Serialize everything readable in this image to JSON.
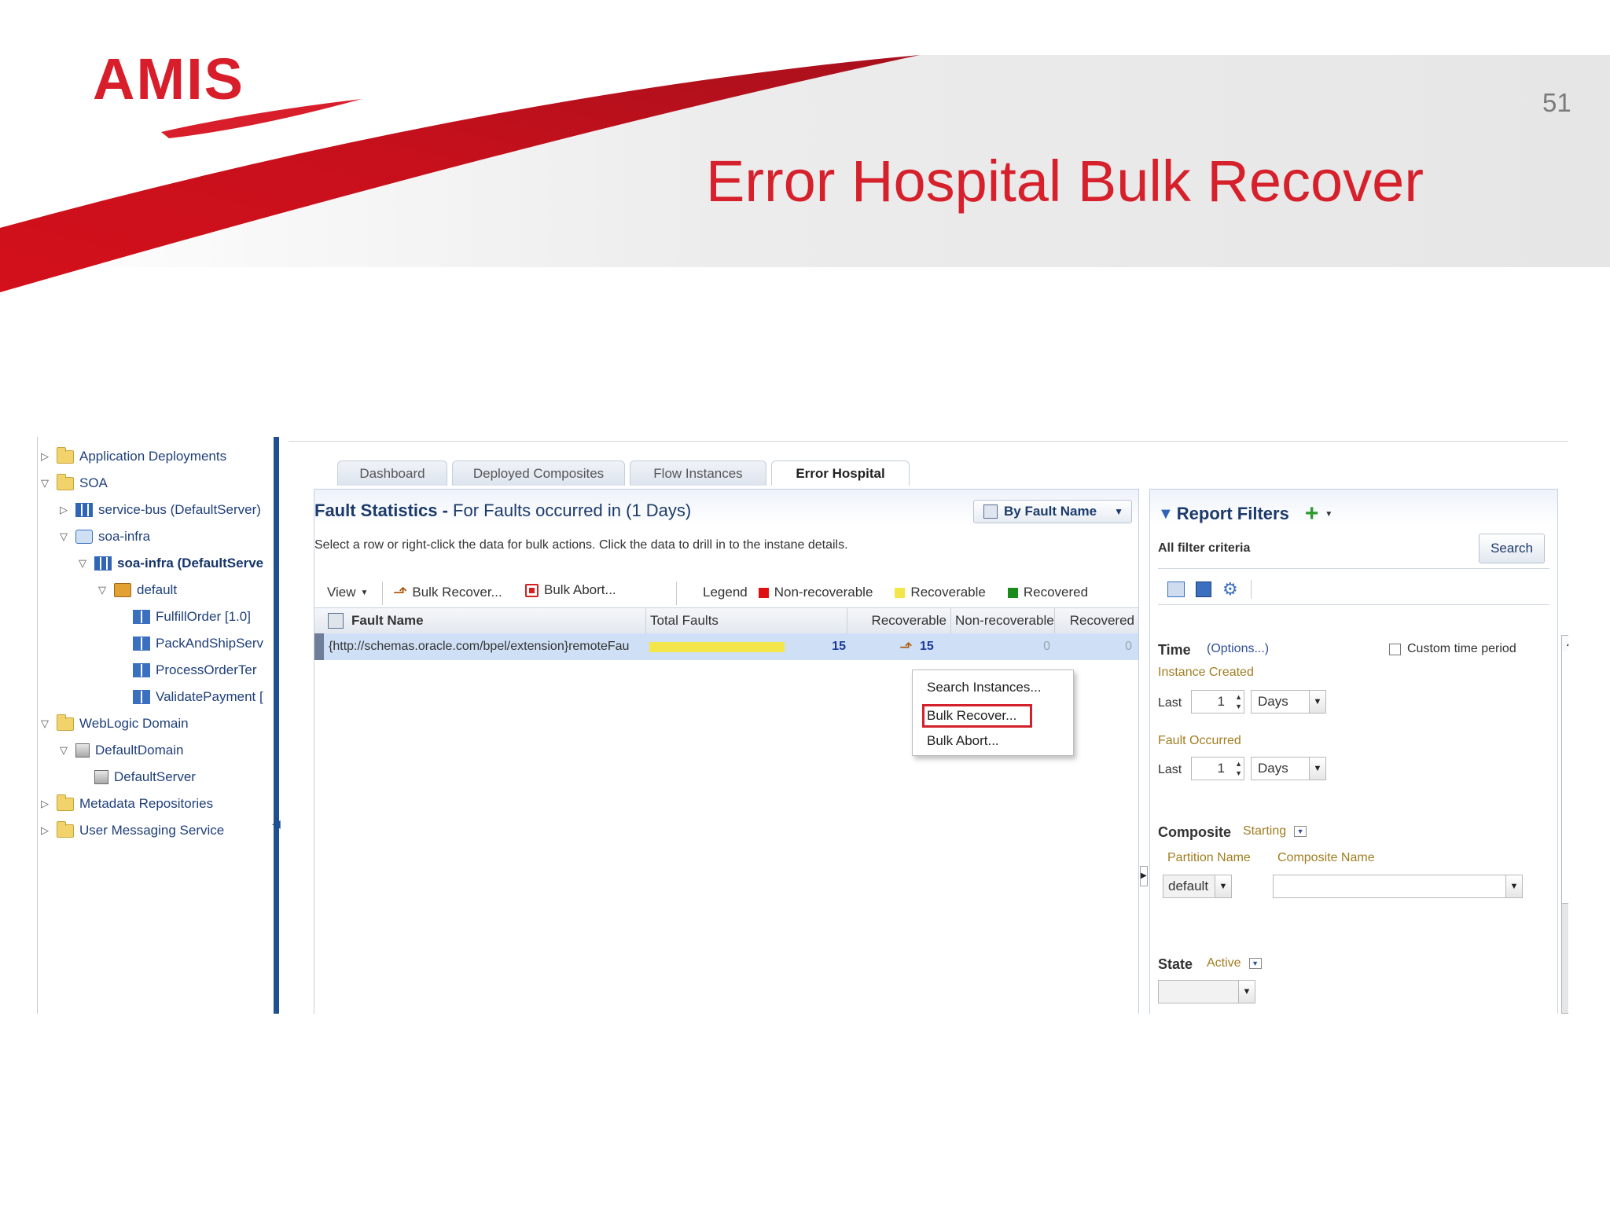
{
  "slide": {
    "logo": "AMIS",
    "number": "51",
    "title": "Error Hospital Bulk Recover"
  },
  "tree": {
    "items": [
      {
        "label": "Application Deployments",
        "twisty": "▷",
        "icon": "folder"
      },
      {
        "label": "SOA",
        "twisty": "▽",
        "icon": "folder"
      },
      {
        "label": "service-bus (DefaultServer)",
        "twisty": "▷",
        "icon": "grid"
      },
      {
        "label": "soa-infra",
        "twisty": "▽",
        "icon": "infra"
      },
      {
        "label": "soa-infra (DefaultServe",
        "twisty": "▽",
        "icon": "grid"
      },
      {
        "label": "default",
        "twisty": "▽",
        "icon": "cube"
      },
      {
        "label": "FulfillOrder [1.0]",
        "twisty": "",
        "icon": "comp"
      },
      {
        "label": "PackAndShipServ",
        "twisty": "",
        "icon": "comp"
      },
      {
        "label": "ProcessOrderTer",
        "twisty": "",
        "icon": "comp"
      },
      {
        "label": "ValidatePayment [",
        "twisty": "",
        "icon": "comp"
      },
      {
        "label": "WebLogic Domain",
        "twisty": "▽",
        "icon": "folder"
      },
      {
        "label": "DefaultDomain",
        "twisty": "▽",
        "icon": "server"
      },
      {
        "label": "DefaultServer",
        "twisty": "",
        "icon": "server"
      },
      {
        "label": "Metadata Repositories",
        "twisty": "▷",
        "icon": "folder"
      },
      {
        "label": "User Messaging Service",
        "twisty": "▷",
        "icon": "folder"
      }
    ]
  },
  "tabs": [
    {
      "label": "Dashboard"
    },
    {
      "label": "Deployed Composites"
    },
    {
      "label": "Flow Instances"
    },
    {
      "label": "Error Hospital"
    }
  ],
  "faults": {
    "title_bold": "Fault Statistics -",
    "title_rest": "For Faults occurred in (1 Days)",
    "group_by": "By Fault Name",
    "hint": "Select a row or right-click the data for bulk actions. Click the data to drill in to the instane details.",
    "toolbar": {
      "view": "View",
      "bulk_recover": "Bulk Recover...",
      "bulk_abort": "Bulk Abort...",
      "legend": "Legend",
      "non_recoverable": "Non-recoverable",
      "recoverable": "Recoverable",
      "recovered": "Recovered"
    },
    "legend_colors": {
      "non_recoverable": "#e01010",
      "recoverable": "#f3e64a",
      "recovered": "#1a8a1a"
    },
    "columns": [
      "Fault Name",
      "Total Faults",
      "Recoverable",
      "Non-recoverable",
      "Recovered"
    ],
    "row": {
      "fault_name": "{http://schemas.oracle.com/bpel/extension}remoteFau",
      "total_faults": "15",
      "recoverable": "15",
      "non_recoverable": "0",
      "recovered": "0"
    }
  },
  "context_menu": {
    "items": [
      "Search Instances...",
      "Bulk Recover...",
      "Bulk Abort..."
    ]
  },
  "filters": {
    "title": "Report Filters",
    "all_criteria": "All filter criteria",
    "search": "Search",
    "time_label": "Time",
    "options": "(Options...)",
    "custom_time": "Custom time period",
    "instance_created": "Instance Created",
    "fault_occurred": "Fault Occurred",
    "last": "Last",
    "last_value_1": "1",
    "last_value_2": "1",
    "unit_1": "Days",
    "unit_2": "Days",
    "composite_label": "Composite",
    "composite_mode": "Starting",
    "partition_name": "Partition Name",
    "composite_name": "Composite Name",
    "partition_value": "default",
    "composite_value": "",
    "state_label": "State",
    "state_mode": "Active",
    "state_value": ""
  }
}
